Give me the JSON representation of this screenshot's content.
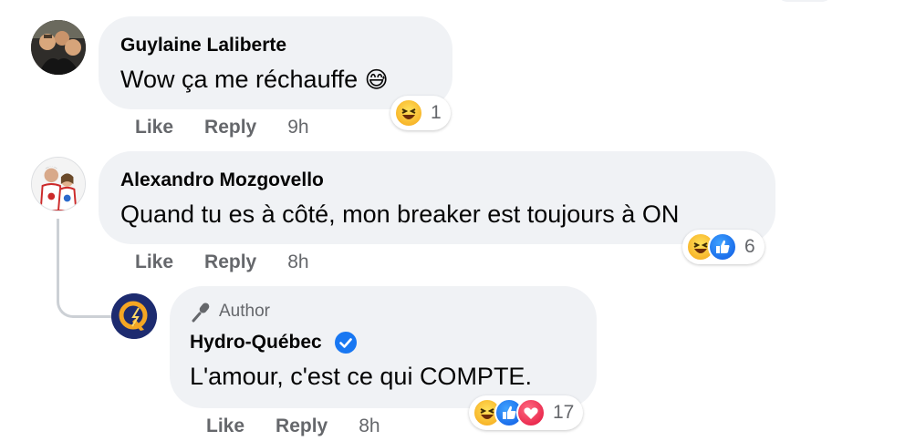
{
  "comments": [
    {
      "author": "Guylaine Laliberte",
      "text": "Wow ça me réchauffe",
      "emoji": "😅",
      "actions": {
        "like": "Like",
        "reply": "Reply",
        "time": "9h"
      },
      "reactions": {
        "icons": [
          "haha"
        ],
        "count": "1"
      }
    },
    {
      "author": "Alexandro Mozgovello",
      "text": "Quand tu es à côté, mon breaker est toujours à ON",
      "actions": {
        "like": "Like",
        "reply": "Reply",
        "time": "8h"
      },
      "reactions": {
        "icons": [
          "haha",
          "like"
        ],
        "count": "6"
      }
    },
    {
      "badge": "Author",
      "author": "Hydro-Québec",
      "verified": true,
      "text": "L'amour, c'est ce qui COMPTE.",
      "actions": {
        "like": "Like",
        "reply": "Reply",
        "time": "8h"
      },
      "reactions": {
        "icons": [
          "haha",
          "like",
          "love"
        ],
        "count": "17"
      }
    }
  ],
  "colors": {
    "bubble": "#f0f2f5",
    "meta_text": "#65676b",
    "verified": "#1877f2",
    "haha": "#f7b125",
    "like": "#1767e8",
    "love": "#e8244a"
  }
}
